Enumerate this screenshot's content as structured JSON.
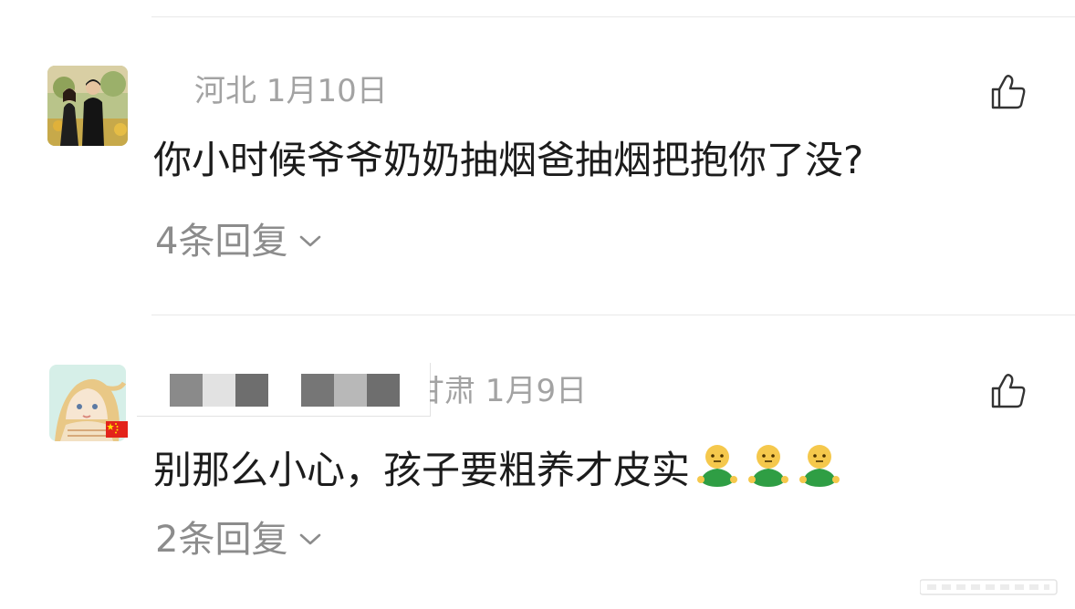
{
  "comments": [
    {
      "location_date": "河北 1月10日",
      "text": "你小时候爷爷奶奶抽烟爸抽烟把抱你了没?",
      "replies_label": "4条回复"
    },
    {
      "location_date": "甘肃 1月9日",
      "text": "别那么小心，孩子要粗养才皮实",
      "replies_label": "2条回复",
      "emoji_count": 3
    }
  ],
  "icons": {
    "like": "thumbs-up-icon",
    "chevron": "chevron-down-icon",
    "emoji": "green-figure-emoji-icon",
    "flag": "china-flag-icon"
  },
  "colors": {
    "meta_text": "#a3a3a3",
    "reply_text": "#8c8c8c",
    "divider": "#e8e8e8",
    "emoji_green": "#2f9e44"
  }
}
